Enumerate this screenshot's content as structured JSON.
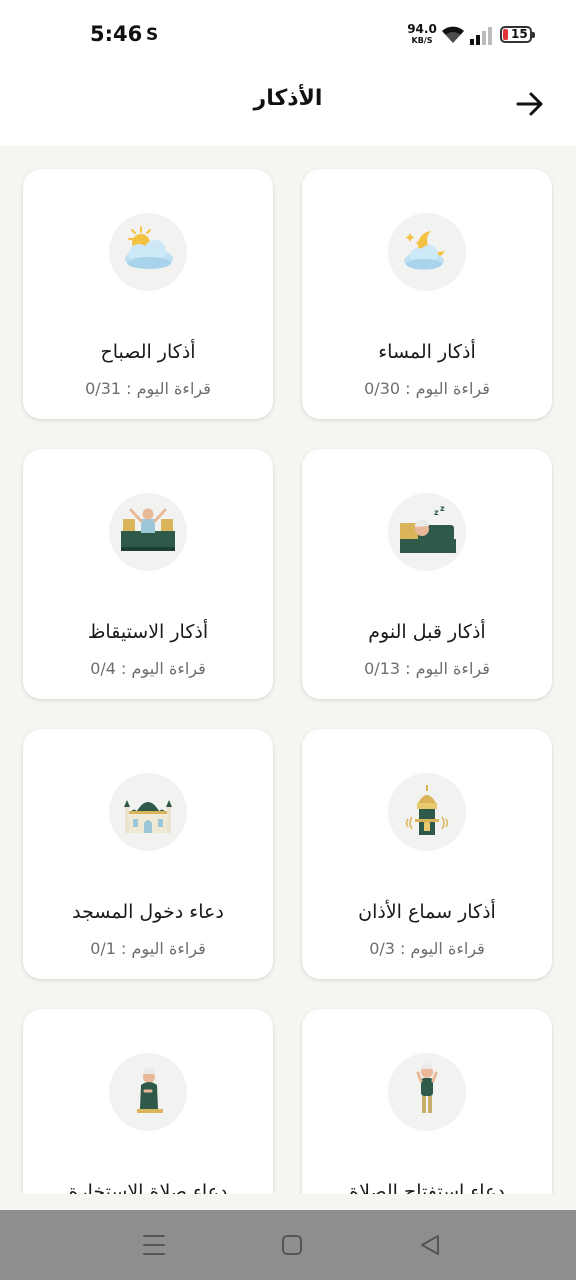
{
  "status_bar": {
    "time": "5:46",
    "carrier_glyph": "S",
    "net_speed_value": "94.0",
    "net_speed_unit": "KB/S",
    "battery_level": "15",
    "battery_color": "#e2343a"
  },
  "header": {
    "title": "الأذكار",
    "back_icon": "arrow-right-icon"
  },
  "cards": [
    {
      "title": "أذكار الصباح",
      "progress": "قراءة اليوم : 0/31",
      "icon": "sun-cloud-icon"
    },
    {
      "title": "أذكار المساء",
      "progress": "قراءة اليوم : 0/30",
      "icon": "moon-cloud-icon"
    },
    {
      "title": "أذكار الاستيقاظ",
      "progress": "قراءة اليوم : 0/4",
      "icon": "waking-up-icon"
    },
    {
      "title": "أذكار قبل النوم",
      "progress": "قراءة اليوم : 0/13",
      "icon": "sleeping-icon"
    },
    {
      "title": "دعاء دخول المسجد",
      "progress": "قراءة اليوم : 0/1",
      "icon": "mosque-icon"
    },
    {
      "title": "أذكار سماع الأذان",
      "progress": "قراءة اليوم : 0/3",
      "icon": "minaret-icon"
    },
    {
      "title": "دعاء صلاة الاستخارة",
      "progress": "",
      "icon": "praying-man-icon"
    },
    {
      "title": "دعاء استفتاح الصلاة",
      "progress": "",
      "icon": "standing-prayer-icon"
    }
  ],
  "nav": {
    "recent_icon": "menu-lines-icon",
    "home_icon": "square-icon",
    "back_icon": "triangle-back-icon"
  },
  "colors": {
    "background": "#f5f5f1",
    "card": "#ffffff",
    "icon_circle": "#f2f3f1",
    "accent_green": "#2f5a4a",
    "nav_bar": "#8e8e8e"
  }
}
